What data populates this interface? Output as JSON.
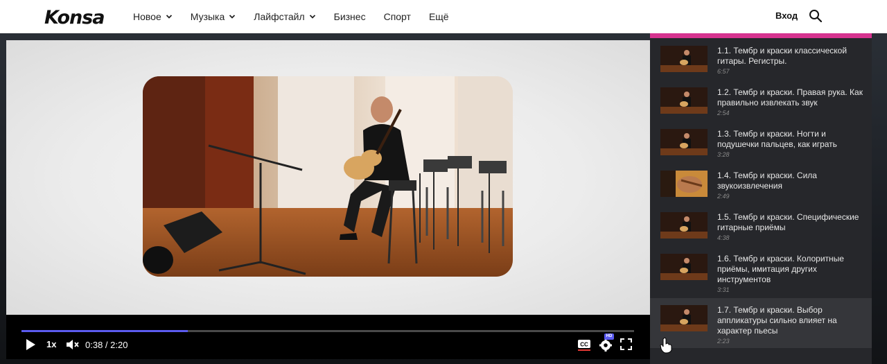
{
  "header": {
    "logo_text": "Konsa",
    "nav": [
      {
        "label": "Новое",
        "has_dropdown": true
      },
      {
        "label": "Музыка",
        "has_dropdown": true
      },
      {
        "label": "Лайфстайл",
        "has_dropdown": true
      },
      {
        "label": "Бизнес",
        "has_dropdown": false
      },
      {
        "label": "Спорт",
        "has_dropdown": false
      },
      {
        "label": "Ещё",
        "has_dropdown": false
      }
    ],
    "login_label": "Вход",
    "search_icon": "search-icon"
  },
  "player": {
    "time_display": "0:38 / 2:20",
    "current_time": "0:38",
    "duration": "2:20",
    "progress_fraction": 0.271,
    "speed_label": "1x",
    "quality_badge": "HD",
    "accent_color": "#5b5bf0",
    "icons": [
      "play-icon",
      "mute-icon",
      "closed-captions-icon",
      "settings-icon",
      "fullscreen-icon"
    ]
  },
  "playlist": {
    "accent_color": "#d6338f",
    "items": [
      {
        "title": "1.1. Тембр и краски классической гитары. Регистры.",
        "duration": "6:57"
      },
      {
        "title": "1.2. Тембр и краски. Правая рука. Как правильно извлекать звук",
        "duration": "2:54"
      },
      {
        "title": "1.3. Тембр и краски. Ногти и подушечки пальцев, как играть",
        "duration": "3:28"
      },
      {
        "title": "1.4. Тембр и краски. Сила звукоизвлечения",
        "duration": "2:49"
      },
      {
        "title": "1.5. Тембр и краски. Специфические гитарные приёмы",
        "duration": "4:38"
      },
      {
        "title": "1.6. Тембр и краски. Колоритные приёмы, имитация других инструментов",
        "duration": "3:31"
      },
      {
        "title": "1.7. Тембр и краски. Выбор аппликатуры сильно влияет на характер пьесы",
        "duration": "2:23"
      }
    ],
    "active_index": 6
  }
}
